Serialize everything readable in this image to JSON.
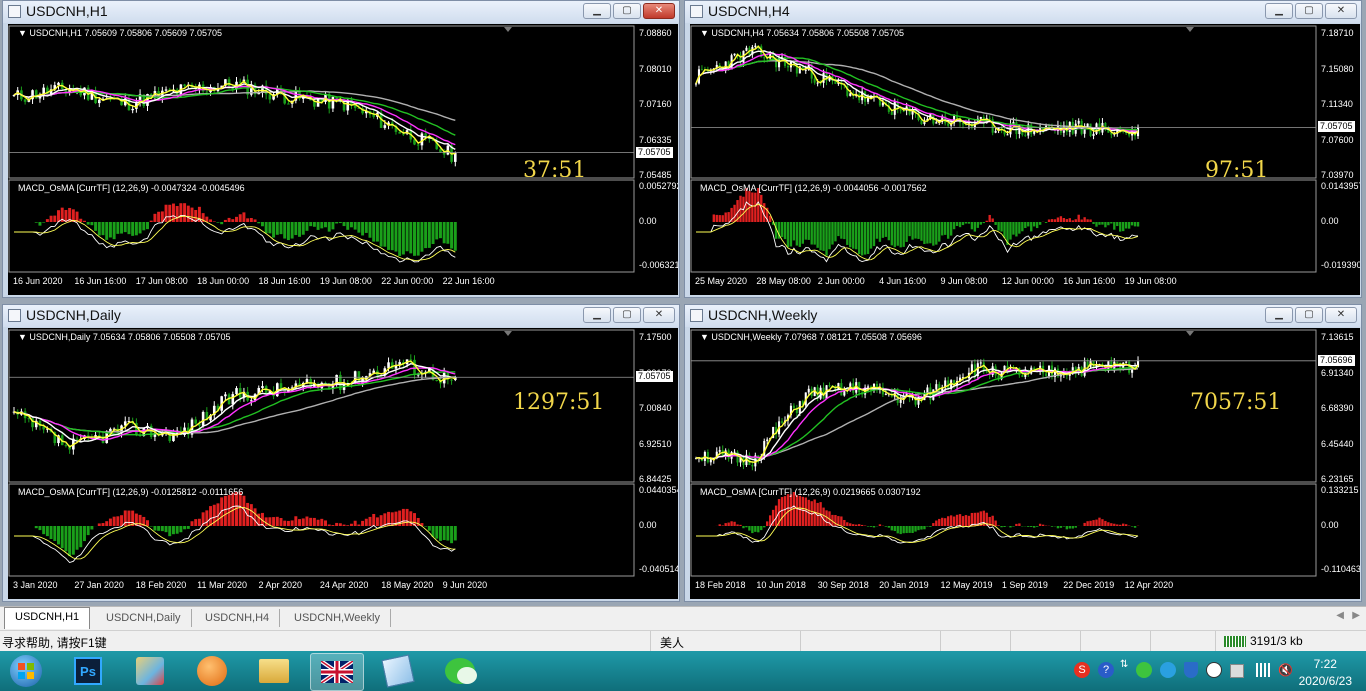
{
  "windows": [
    {
      "id": "h1",
      "title": "USDCNH,H1",
      "chart_header": "USDCNH,H1  7.05609 7.05806 7.05609 7.05705",
      "price_ticks": [
        "7.08860",
        "7.08010",
        "7.07160",
        "7.06335",
        "7.05485"
      ],
      "current_price": "7.05705",
      "timer": "37:51",
      "macd_header": "MACD_OsMA [CurrTF] (12,26,9) -0.0047324 -0.0045496",
      "macd_ticks": [
        "0.0052792",
        "0.00",
        "-0.0063210"
      ],
      "time_ticks": [
        "16 Jun 2020",
        "16 Jun 16:00",
        "17 Jun 08:00",
        "18 Jun 00:00",
        "18 Jun 16:00",
        "19 Jun 08:00",
        "22 Jun 00:00",
        "22 Jun 16:00"
      ]
    },
    {
      "id": "h4",
      "title": "USDCNH,H4",
      "chart_header": "USDCNH,H4  7.05634 7.05806 7.05508 7.05705",
      "price_ticks": [
        "7.18710",
        "7.15080",
        "7.11340",
        "7.07600",
        "7.03970"
      ],
      "current_price": "7.05705",
      "timer": "97:51",
      "macd_header": "MACD_OsMA [CurrTF] (12,26,9) -0.0044056 -0.0017562",
      "macd_ticks": [
        "0.0143957",
        "0.00",
        "-0.019390"
      ],
      "time_ticks": [
        "25 May 2020",
        "28 May 08:00",
        "2 Jun 00:00",
        "4 Jun 16:00",
        "9 Jun 08:00",
        "12 Jun 00:00",
        "16 Jun 16:00",
        "19 Jun 08:00"
      ]
    },
    {
      "id": "daily",
      "title": "USDCNH,Daily",
      "chart_header": "USDCNH,Daily  7.05634 7.05806 7.05508 7.05705",
      "price_ticks": [
        "7.17500",
        "7.09170",
        "7.00840",
        "6.92510",
        "6.84425"
      ],
      "current_price": "7.05705",
      "timer": "1297:51",
      "macd_header": "MACD_OsMA [CurrTF] (12,26,9) -0.0125812 -0.0111656",
      "macd_ticks": [
        "0.0440354",
        "0.00",
        "-0.040514"
      ],
      "time_ticks": [
        "3 Jan 2020",
        "27 Jan 2020",
        "18 Feb 2020",
        "11 Mar 2020",
        "2 Apr 2020",
        "24 Apr 2020",
        "18 May 2020",
        "9 Jun 2020"
      ]
    },
    {
      "id": "weekly",
      "title": "USDCNH,Weekly",
      "chart_header": "USDCNH,Weekly  7.07968 7.08121 7.05508 7.05696",
      "price_ticks": [
        "7.13615",
        "6.91340",
        "6.68390",
        "6.45440",
        "6.23165"
      ],
      "current_price": "7.05696",
      "timer": "7057:51",
      "macd_header": "MACD_OsMA [CurrTF] (12,26,9) 0.0219665 0.0307192",
      "macd_ticks": [
        "0.133215",
        "0.00",
        "-0.110463"
      ],
      "time_ticks": [
        "18 Feb 2018",
        "10 Jun 2018",
        "30 Sep 2018",
        "20 Jan 2019",
        "12 May 2019",
        "1 Sep 2019",
        "22 Dec 2019",
        "12 Apr 2020"
      ]
    }
  ],
  "tabs": [
    "USDCNH,H1",
    "USDCNH,Daily",
    "USDCNH,H4",
    "USDCNH,Weekly"
  ],
  "status": {
    "help": "寻求帮助, 请按F1键",
    "profile": "美人",
    "traffic": "3191/3 kb"
  },
  "taskbar": {
    "time": "7:22",
    "date": "2020/6/23",
    "apps": [
      "start",
      "photoshop",
      "app-maps",
      "app-orange",
      "explorer",
      "app-flag",
      "app-notes",
      "wechat"
    ]
  },
  "colors": {
    "bull": "#ffffff",
    "bear": "#1aa01a",
    "ma_fast": "#ffff33",
    "ma_mid": "#ff33ff",
    "ma_slow": "#22c022",
    "ma_long": "#b0b0b0",
    "hist_pos": "#e02020",
    "hist_neg": "#1aa01a",
    "timer": "#f1d64a"
  }
}
